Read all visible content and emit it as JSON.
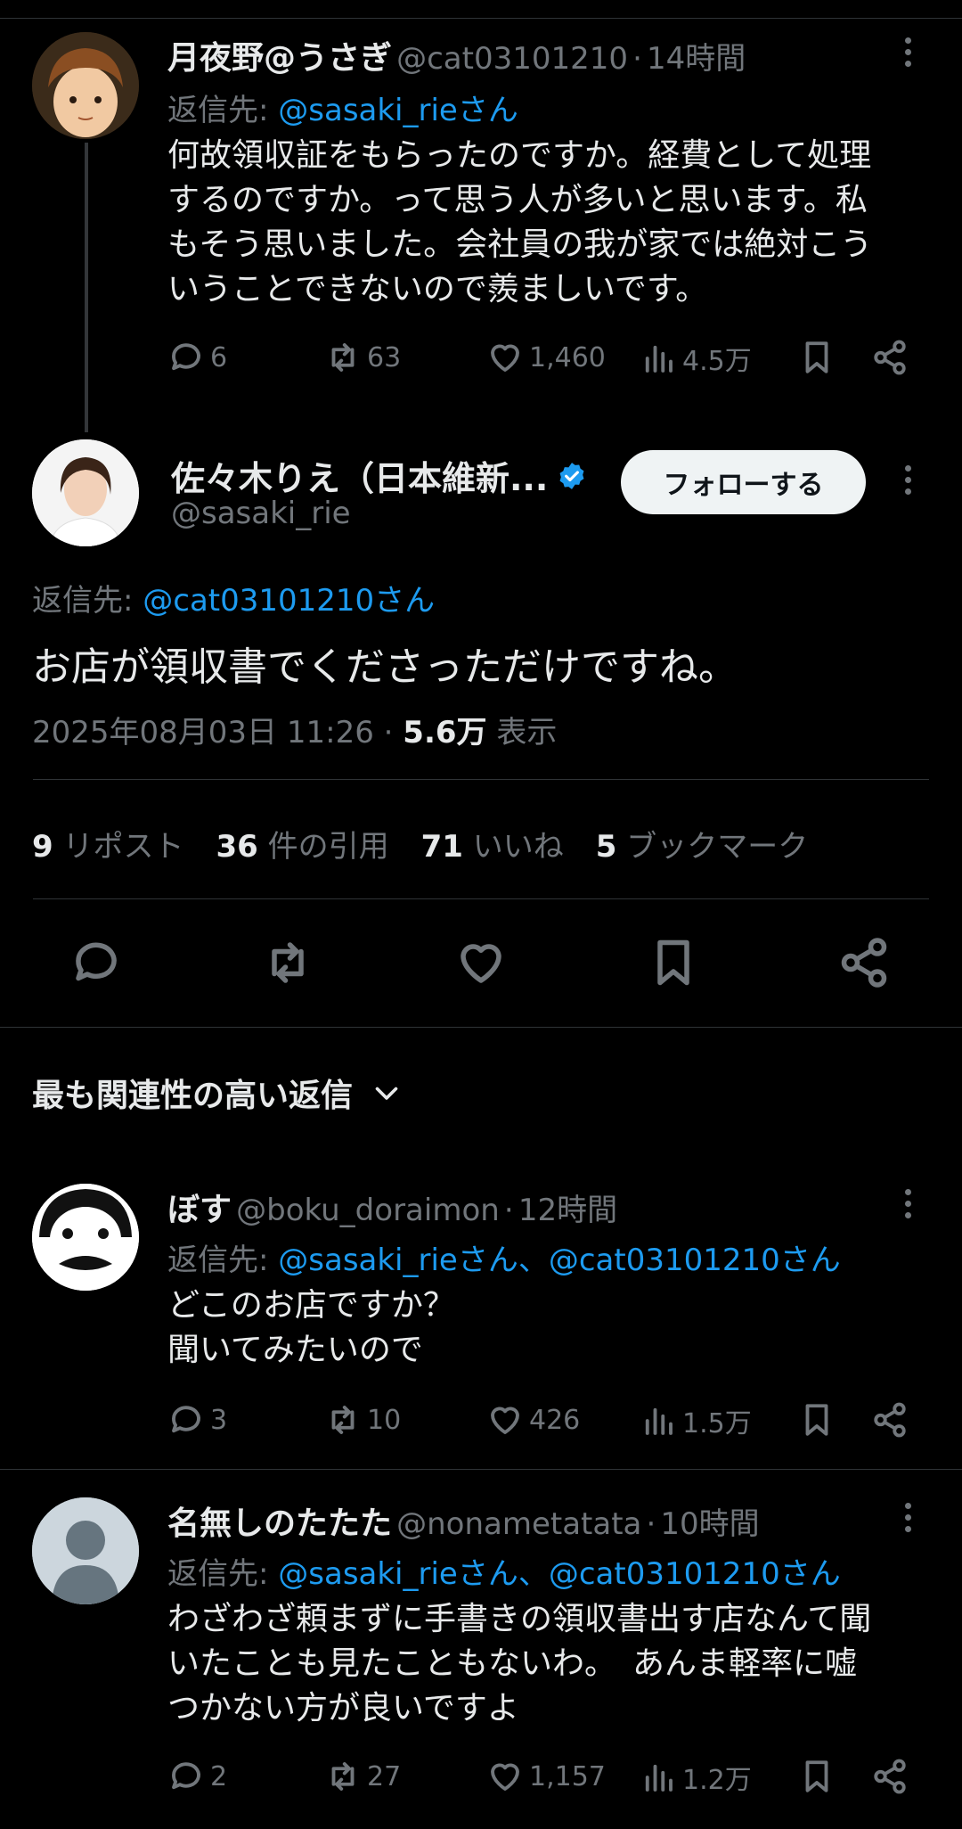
{
  "tweet1": {
    "name": "月夜野@うさぎ",
    "handle": "@cat03101210",
    "time": "14時間",
    "reply_label": "返信先: ",
    "reply_to": "@sasaki_rieさん",
    "text": "何故領収証をもらったのですか。経費として処理\nするのですか。って思う人が多いと思います。私\nもそう思いました。会社員の我が家では絶対こう\nいうことできないので羨ましいです。",
    "replies": "6",
    "retweets": "63",
    "likes": "1,460",
    "views": "4.5万"
  },
  "main": {
    "name": "佐々木りえ（日本維新...",
    "handle": "@sasaki_rie",
    "follow_label": "フォローする",
    "reply_label": "返信先: ",
    "reply_to": "@cat03101210さん",
    "text": "お店が領収書でくださっただけですね。",
    "datetime": "2025年08月03日 11:26",
    "views_num": "5.6万",
    "views_label": "表示",
    "stats": [
      {
        "num": "9",
        "label": "リポスト"
      },
      {
        "num": "36",
        "label": "件の引用"
      },
      {
        "num": "71",
        "label": "いいね"
      },
      {
        "num": "5",
        "label": "ブックマーク"
      }
    ]
  },
  "sort_label": "最も関連性の高い返信",
  "reply1": {
    "name": "ぼす",
    "handle": "@boku_doraimon",
    "time": "12時間",
    "reply_label": "返信先: ",
    "reply_to": "@sasaki_rieさん、@cat03101210さん",
    "text": "どこのお店ですか？\n聞いてみたいので",
    "replies": "3",
    "retweets": "10",
    "likes": "426",
    "views": "1.5万"
  },
  "reply2": {
    "name": "名無しのたたた",
    "handle": "@nonametatata",
    "time": "10時間",
    "reply_label": "返信先: ",
    "reply_to": "@sasaki_rieさん、@cat03101210さん",
    "text": "わざわざ頼まずに手書きの領収書出す店なんて聞\nいたことも見たこともないわ。　あんま軽率に嘘\nつかない方が良いですよ",
    "replies": "2",
    "retweets": "27",
    "likes": "1,157",
    "views": "1.2万"
  },
  "colors": {
    "accent": "#1d9bf0",
    "muted": "#71767b",
    "text": "#e7e9ea",
    "divider": "#2f3336"
  }
}
